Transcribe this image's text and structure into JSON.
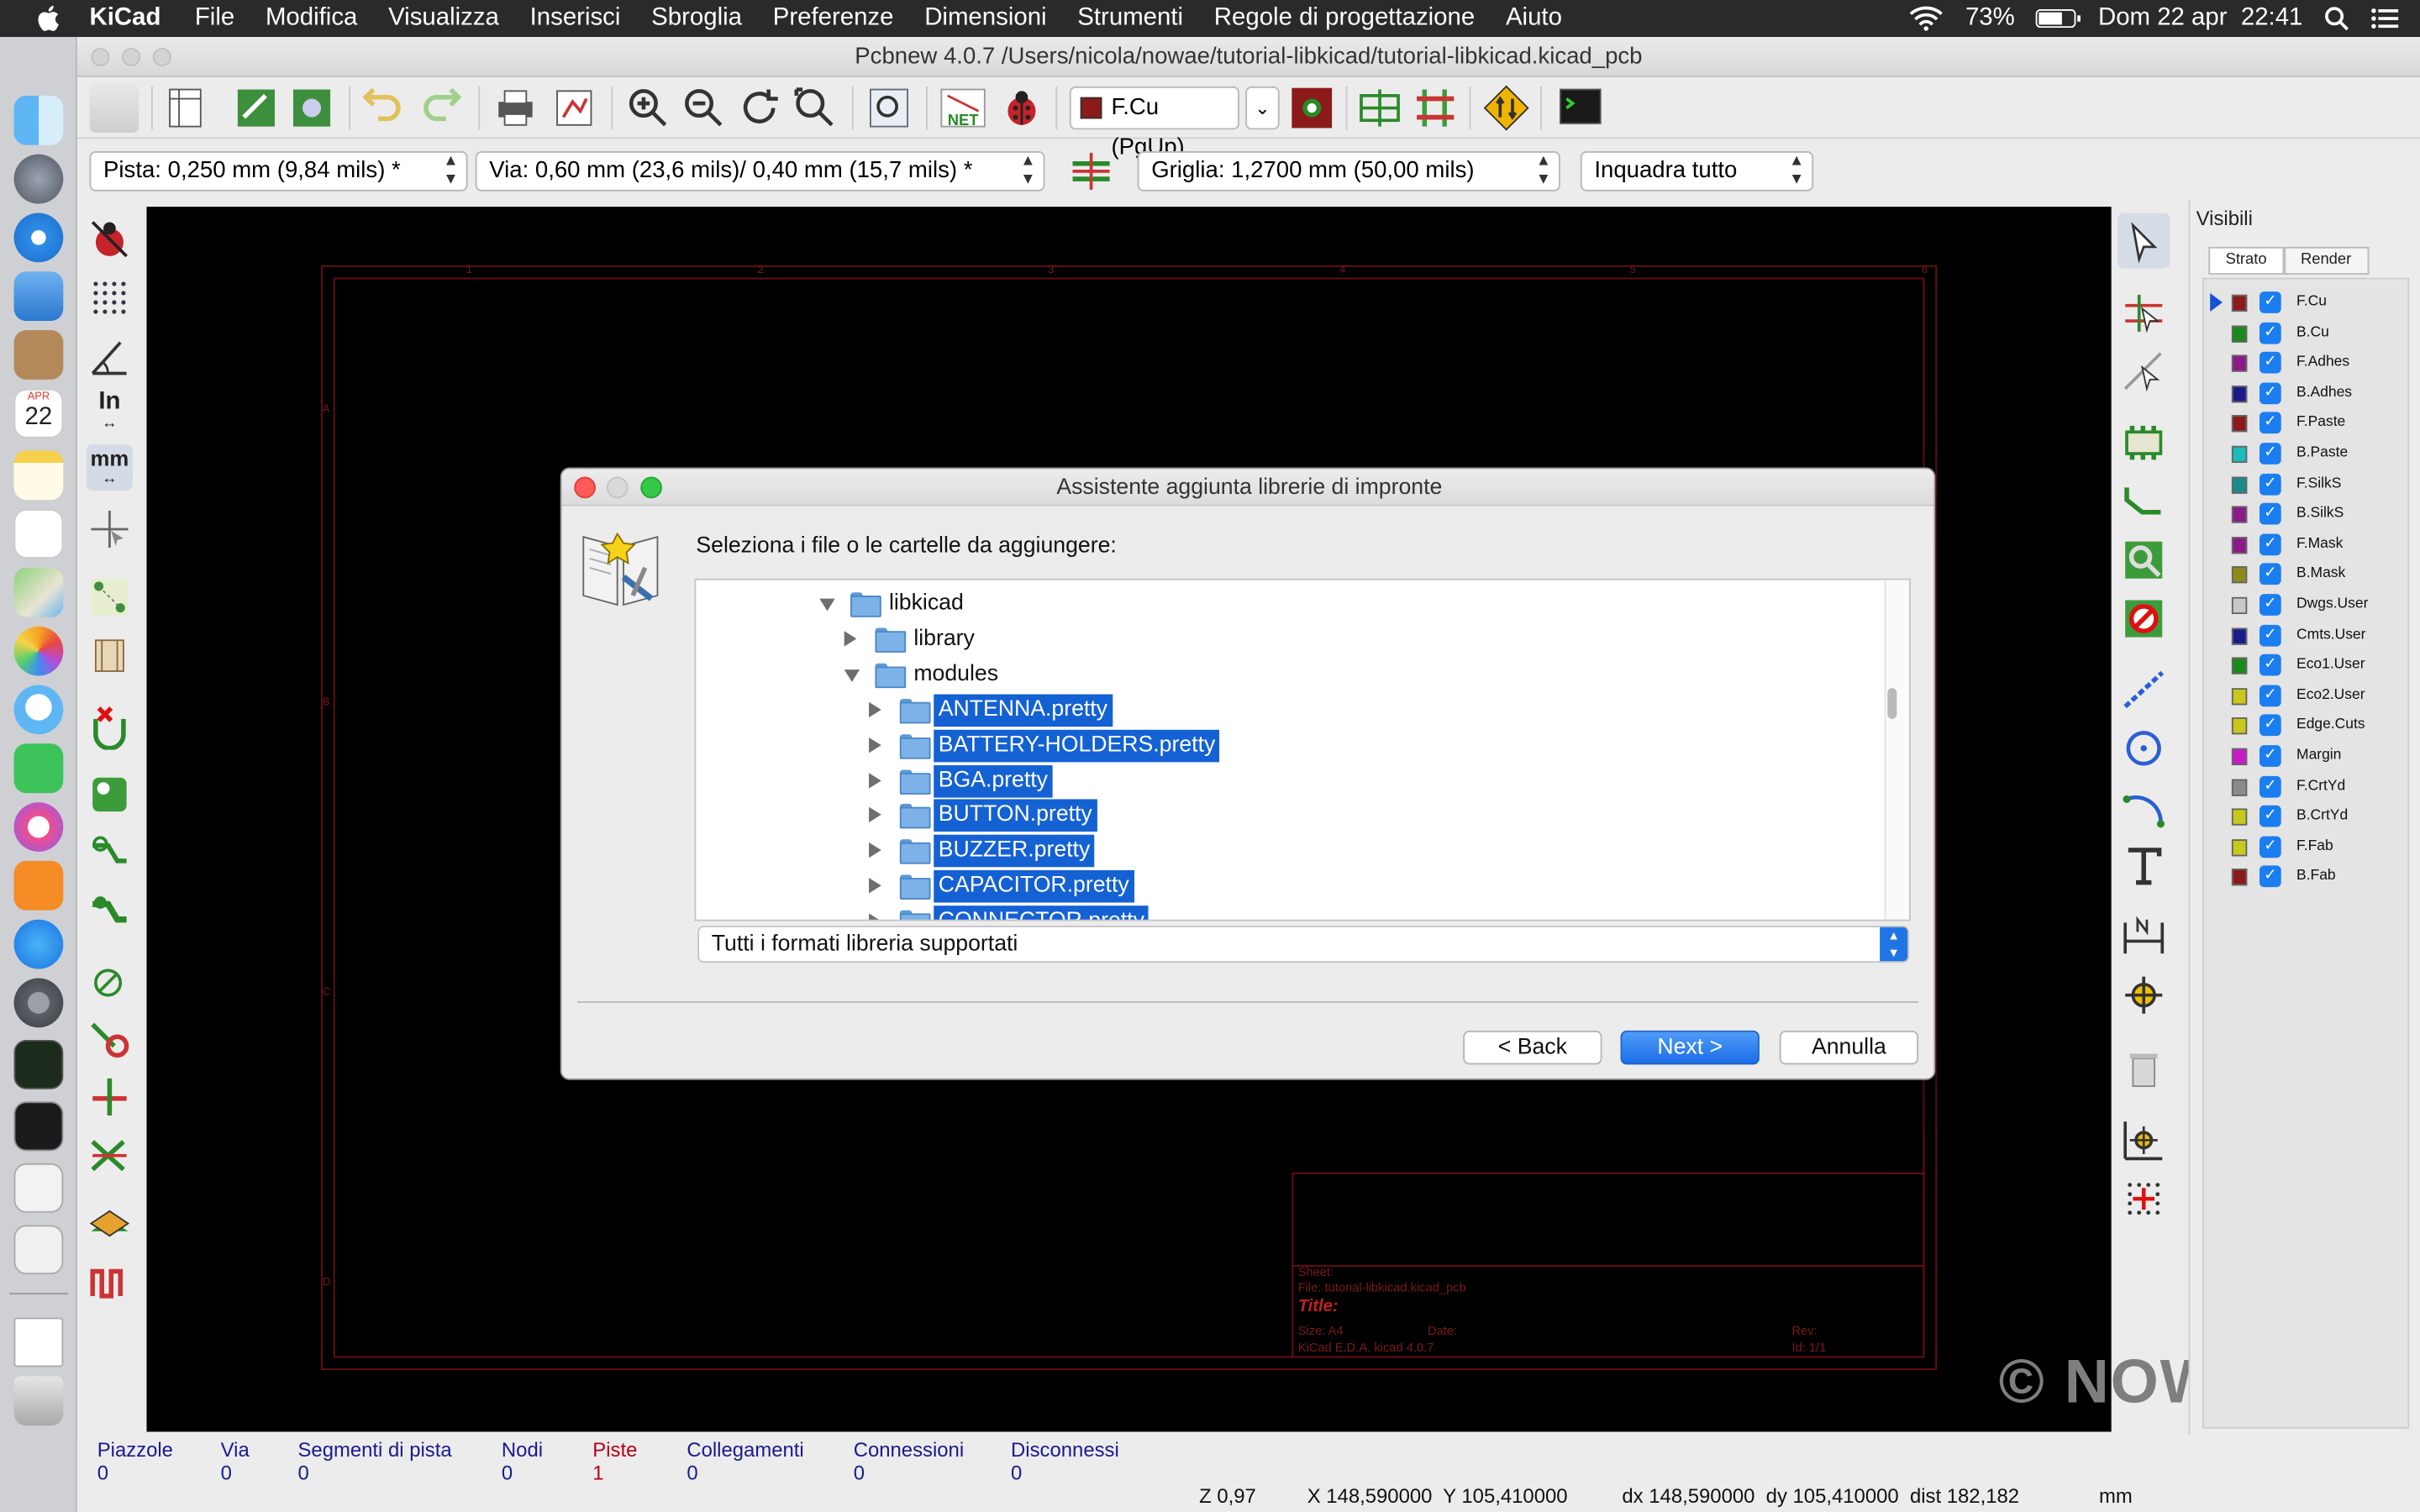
{
  "menubar": {
    "app": "KiCad",
    "items": [
      "File",
      "Modifica",
      "Visualizza",
      "Inserisci",
      "Sbroglia",
      "Preferenze",
      "Dimensioni",
      "Strumenti",
      "Regole di progettazione",
      "Aiuto"
    ],
    "battery": "73%",
    "battery_level": 0.73,
    "datetime": "Dom 22 apr  22:41"
  },
  "dock": {
    "calendar_month": "APR",
    "calendar_day": "22"
  },
  "window": {
    "title": "Pcbnew 4.0.7 /Users/nicola/nowae/tutorial-libkicad/tutorial-libkicad.kicad_pcb"
  },
  "toolbar": {
    "layer": "F.Cu (PgUp)",
    "layer_color": "#8b1a1a",
    "track_width": "Pista: 0,250 mm (9,84 mils) *",
    "via_size": "Via: 0,60 mm (23,6 mils)/ 0,40 mm (15,7 mils) *",
    "grid": "Griglia: 1,2700 mm (50,00 mils)",
    "zoom": "Inquadra tutto",
    "net_label": "NET"
  },
  "lefttool": {
    "in_label": "In",
    "mm_label": "mm"
  },
  "canvas": {
    "title_block": {
      "sheet": "Sheet:",
      "file": "File: tutorial-libkicad.kicad_pcb",
      "title": "Title:",
      "size": "Size: A4",
      "date": "Date:",
      "rev": "Rev:",
      "program": "KiCad E.D.A.  kicad 4.0.7",
      "id": "Id: 1/1"
    },
    "watermark": "© NOWAE",
    "border_numbers": [
      "1",
      "2",
      "3",
      "4",
      "5",
      "6"
    ],
    "border_letters": [
      "A",
      "B",
      "C",
      "D"
    ]
  },
  "layers_panel": {
    "title": "Visibili",
    "tabs": [
      "Strato",
      "Render"
    ],
    "layers": [
      {
        "name": "F.Cu",
        "color": "#8b1a1a",
        "active": true
      },
      {
        "name": "B.Cu",
        "color": "#1a8b1a"
      },
      {
        "name": "F.Adhes",
        "color": "#8b1a8b"
      },
      {
        "name": "B.Adhes",
        "color": "#1a1a8b"
      },
      {
        "name": "F.Paste",
        "color": "#8b1a1a"
      },
      {
        "name": "B.Paste",
        "color": "#1abcbc"
      },
      {
        "name": "F.SilkS",
        "color": "#1a8b8b"
      },
      {
        "name": "B.SilkS",
        "color": "#8b1a8b"
      },
      {
        "name": "F.Mask",
        "color": "#8b1a8b"
      },
      {
        "name": "B.Mask",
        "color": "#8b8b1a"
      },
      {
        "name": "Dwgs.User",
        "color": "#c8c8c8"
      },
      {
        "name": "Cmts.User",
        "color": "#1a1a8b"
      },
      {
        "name": "Eco1.User",
        "color": "#1a8b1a"
      },
      {
        "name": "Eco2.User",
        "color": "#c8c81a"
      },
      {
        "name": "Edge.Cuts",
        "color": "#c8c81a"
      },
      {
        "name": "Margin",
        "color": "#c81ac8"
      },
      {
        "name": "F.CrtYd",
        "color": "#8b8b8b"
      },
      {
        "name": "B.CrtYd",
        "color": "#c8c81a"
      },
      {
        "name": "F.Fab",
        "color": "#c8c81a"
      },
      {
        "name": "B.Fab",
        "color": "#8b1a1a"
      }
    ]
  },
  "status": {
    "fields": [
      {
        "label": "Piazzole",
        "value": "0",
        "color": "#1a1a8e"
      },
      {
        "label": "Via",
        "value": "0",
        "color": "#1a1a8e"
      },
      {
        "label": "Segmenti di pista",
        "value": "0",
        "color": "#1a1a8e"
      },
      {
        "label": "Nodi",
        "value": "0",
        "color": "#1a1a8e"
      },
      {
        "label": "Piste",
        "value": "1",
        "color": "#b3001b"
      },
      {
        "label": "Collegamenti",
        "value": "0",
        "color": "#1a1a8e"
      },
      {
        "label": "Connessioni",
        "value": "0",
        "color": "#1a1a8e"
      },
      {
        "label": "Disconnessi",
        "value": "0",
        "color": "#1a1a8e"
      }
    ],
    "zoom": "Z 0,97",
    "xy": "X 148,590000  Y 105,410000",
    "delta": "dx 148,590000  dy 105,410000  dist 182,182",
    "units": "mm"
  },
  "dialog": {
    "title": "Assistente aggiunta librerie di impronte",
    "prompt": "Seleziona i file o le cartelle da aggiungere:",
    "tree": [
      {
        "label": "libkicad",
        "level": 0,
        "expanded": true,
        "selected": false
      },
      {
        "label": "library",
        "level": 1,
        "expanded": false,
        "selected": false
      },
      {
        "label": "modules",
        "level": 1,
        "expanded": true,
        "selected": false
      },
      {
        "label": "ANTENNA.pretty",
        "level": 2,
        "expanded": false,
        "selected": true
      },
      {
        "label": "BATTERY-HOLDERS.pretty",
        "level": 2,
        "expanded": false,
        "selected": true
      },
      {
        "label": "BGA.pretty",
        "level": 2,
        "expanded": false,
        "selected": true
      },
      {
        "label": "BUTTON.pretty",
        "level": 2,
        "expanded": false,
        "selected": true
      },
      {
        "label": "BUZZER.pretty",
        "level": 2,
        "expanded": false,
        "selected": true
      },
      {
        "label": "CAPACITOR.pretty",
        "level": 2,
        "expanded": false,
        "selected": true
      },
      {
        "label": "CONNECTOR.pretty",
        "level": 2,
        "expanded": false,
        "selected": true
      }
    ],
    "filter": "Tutti i formati libreria supportati",
    "back": "< Back",
    "next": "Next >",
    "cancel": "Annulla"
  }
}
